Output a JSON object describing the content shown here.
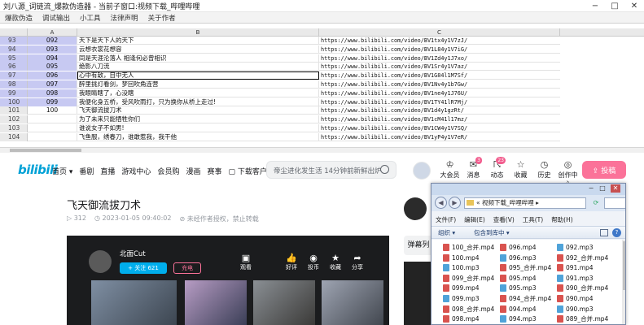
{
  "app": {
    "title": "刘八源_词链流_爆款伪造器 - 当前子窗口:视频下载_哔哩哔哩",
    "window_controls": [
      "−",
      "□",
      "✕"
    ],
    "menu": [
      "爆款伪造",
      "调试输出",
      "小工具",
      "法律声明",
      "关于作者"
    ]
  },
  "sheet": {
    "columns": [
      "A",
      "B",
      "C"
    ],
    "rows": [
      {
        "num": "93",
        "a": "092",
        "b": "天下是天下人的天下",
        "c": "https://www.bilibili.com/video/BV1tx4y1V7zJ/"
      },
      {
        "num": "94",
        "a": "093",
        "b": "云想衣裳花想容",
        "c": "https://www.bilibili.com/video/BV1L84y1V7iG/"
      },
      {
        "num": "95",
        "a": "094",
        "b": "同是天涯沦落人 相逢何必曾相识",
        "c": "https://www.bilibili.com/video/BV1Zd4y1J7xo/"
      },
      {
        "num": "96",
        "a": "095",
        "b": "绝影八刀流",
        "c": "https://www.bilibili.com/video/BV1Sr4y1V7az/"
      },
      {
        "num": "97",
        "a": "096",
        "b": "心中有敌，目中无人",
        "c": "https://www.bilibili.com/video/BV1G84l1M7Sf/"
      },
      {
        "num": "98",
        "a": "097",
        "b": "醉里挑灯看剑，梦回吹角连营",
        "c": "https://www.bilibili.com/video/BV1Nv4y1b7Gw/"
      },
      {
        "num": "99",
        "a": "098",
        "b": "我眼睛瞎了，心没瞎",
        "c": "https://www.bilibili.com/video/BV1ne4y1J76U/"
      },
      {
        "num": "100",
        "a": "099",
        "b": "我便化身五桥，受风吹雨打，只为换你从桥上走过!",
        "c": "https://www.bilibili.com/video/BV1TY41lR7Mj/"
      },
      {
        "num": "101",
        "a": "100",
        "b": "飞天御流拔刀术",
        "c": "https://www.bilibili.com/video/BV1d4y1gzRt/"
      },
      {
        "num": "102",
        "a": "",
        "b": "为了未来只能牺牲你们",
        "c": "https://www.bilibili.com/video/BV1cM41l17mz/"
      },
      {
        "num": "103",
        "a": "",
        "b": "谁说女子不如男!",
        "c": "https://www.bilibili.com/video/BV1CW4y1V7SQ/"
      },
      {
        "num": "104",
        "a": "",
        "b": "飞鱼服，绣春刀，谁敢惹我，我干他",
        "c": "https://www.bilibili.com/video/BV1yP4y1V7eR/"
      }
    ]
  },
  "bili": {
    "logo": "bilibili",
    "nav_links": [
      "首页 ▾",
      "番剧",
      "直播",
      "游戏中心",
      "会员购",
      "漫画",
      "赛事",
      "▢ 下载客户端"
    ],
    "search_placeholder": "帝尘进化发生活 14分钟前新鲜出炉",
    "nav_icons": [
      {
        "label": "大会员",
        "glyph": "♔",
        "badge": ""
      },
      {
        "label": "消息",
        "glyph": "✉",
        "badge": "3"
      },
      {
        "label": "动态",
        "glyph": "☈",
        "badge": "23"
      },
      {
        "label": "收藏",
        "glyph": "☆",
        "badge": ""
      },
      {
        "label": "历史",
        "glyph": "◷",
        "badge": ""
      },
      {
        "label": "创作中心",
        "glyph": "◎",
        "badge": ""
      }
    ],
    "upload_label": "⇪ 投稿",
    "video": {
      "title": "飞天御流拔刀术",
      "views": "▷ 312",
      "time": "◷ 2023-01-05 09:40:02",
      "notice": "⊘ 未经作者授权，禁止转载"
    },
    "side_btn": "弹幕列",
    "player": {
      "channel": "北面Cut",
      "follow": "+ 关注 621",
      "charge": "充电",
      "actions": [
        {
          "label": "观看",
          "glyph": "▣"
        },
        {
          "label": "好评",
          "glyph": "👍"
        },
        {
          "label": "投币",
          "glyph": "◉"
        },
        {
          "label": "收藏",
          "glyph": "★"
        },
        {
          "label": "分享",
          "glyph": "➦"
        }
      ]
    }
  },
  "explorer": {
    "title_controls": [
      "−",
      "□",
      "✕"
    ],
    "address": "« 视频下载_哔哩哔哩 ▸",
    "menu": [
      "文件(F)",
      "编辑(E)",
      "查看(V)",
      "工具(T)",
      "帮助(H)"
    ],
    "toolbar": {
      "organize": "组织 ▾",
      "include": "包含到库中 ▾",
      "help": "?"
    },
    "files": [
      [
        "100_合并.mp4",
        "096.mp4",
        "092.mp3"
      ],
      [
        "100.mp4",
        "096.mp3",
        "092_合并.mp4"
      ],
      [
        "100.mp3",
        "095_合并.mp4",
        "091.mp4"
      ],
      [
        "099_合并.mp4",
        "095.mp4",
        "091.mp3"
      ],
      [
        "099.mp4",
        "095.mp3",
        "090_合并.mp4"
      ],
      [
        "099.mp3",
        "094_合并.mp4",
        "090.mp4"
      ],
      [
        "098_合并.mp4",
        "094.mp4",
        "090.mp3"
      ],
      [
        "098.mp4",
        "094.mp3",
        "089_合并.mp4"
      ]
    ]
  }
}
